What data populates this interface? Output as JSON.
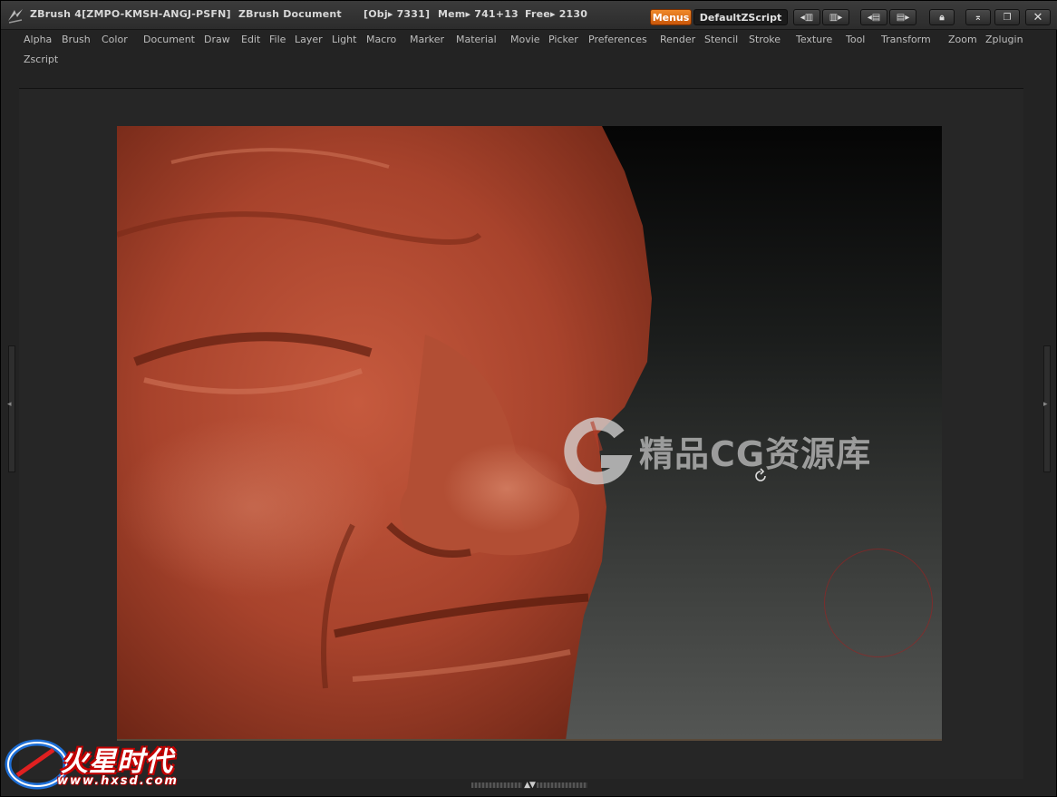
{
  "titlebar": {
    "app_title": "ZBrush 4[ZMPO-KMSH-ANGJ-PSFN]",
    "document": "ZBrush Document",
    "obj_info": "[Obj▸ 7331]",
    "mem_info": "Mem▸ 741+13",
    "free_info": "Free▸ 2130",
    "menus_label": "Menus",
    "script_label": "DefaultZScript"
  },
  "menubar": {
    "items": [
      "Alpha",
      "Brush",
      "Color",
      "Document",
      "Draw",
      "Edit",
      "File",
      "Layer",
      "Light",
      "Macro",
      "Marker",
      "Material",
      "Movie",
      "Picker",
      "Preferences",
      "Render",
      "Stencil",
      "Stroke",
      "Texture",
      "Tool",
      "Transform",
      "Zoom",
      "Zplugin",
      "Zscript"
    ]
  },
  "watermark": {
    "text": "精品CG资源库"
  },
  "brand": {
    "name_cn": "火星时代",
    "url": "www.hxsd.com"
  },
  "colors": {
    "accent": "#e8781c",
    "clay": "#b4452e",
    "brand_red": "#c40000"
  }
}
